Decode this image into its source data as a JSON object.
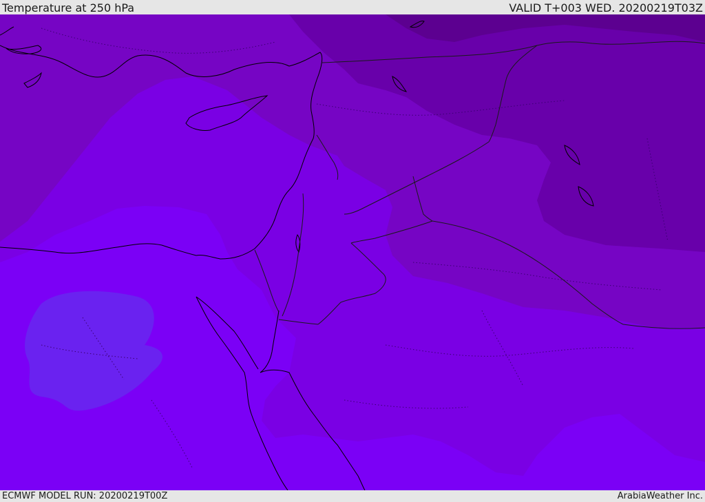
{
  "header": {
    "title": "Temperature at 250 hPa",
    "valid": "VALID T+003 WED. 20200219T03Z"
  },
  "footer": {
    "model_run": "ECMWF MODEL RUN: 20200219T00Z",
    "credit": "ArabiaWeather Inc."
  },
  "colors": {
    "band_warmest": "#6a22f0",
    "band_warm": "#7b00f6",
    "band_mid": "#7a00e4",
    "band_cool": "#7605c4",
    "band_cold": "#6800aa",
    "band_coldest": "#5c0090",
    "coastline": "#000000",
    "border": "#1a1a1a"
  },
  "legend": {}
}
